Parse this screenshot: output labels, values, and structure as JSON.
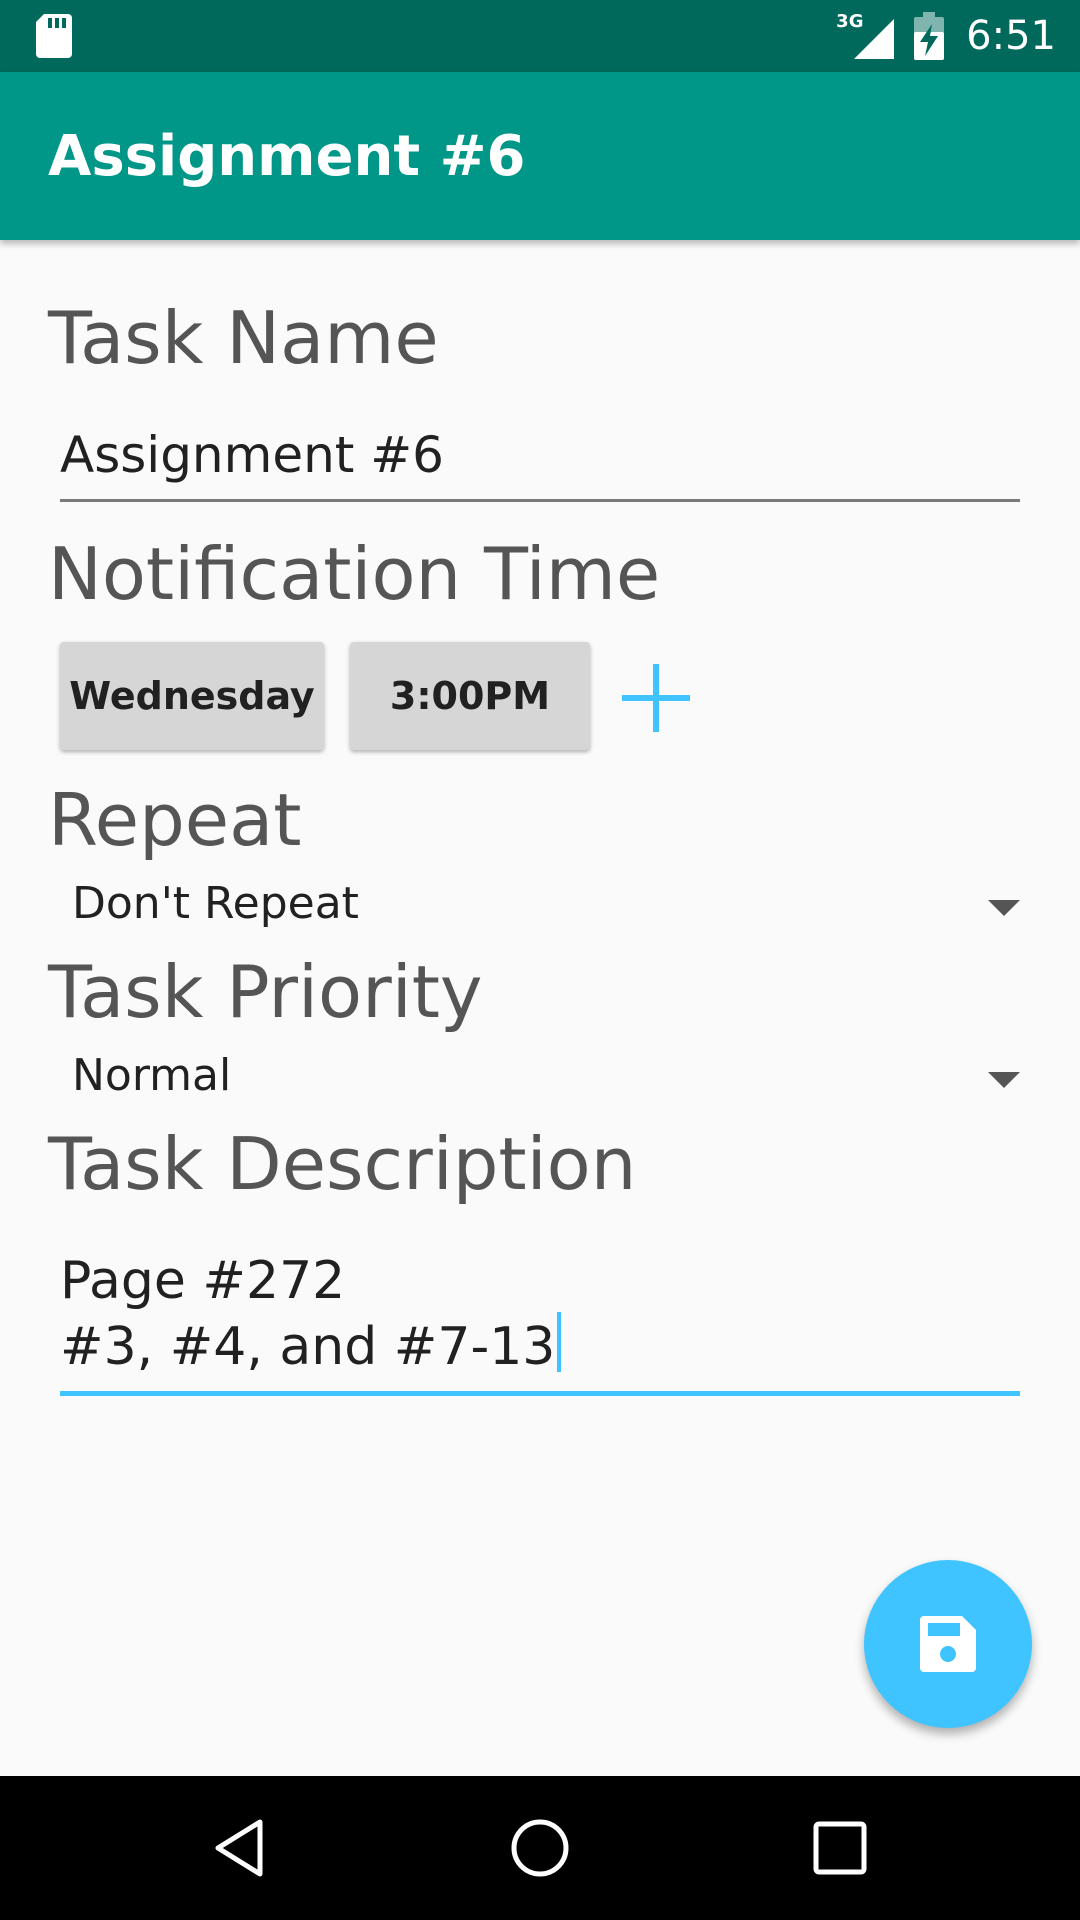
{
  "status_bar": {
    "network_label": "3G",
    "time": "6:51",
    "icons": [
      "sd-card-icon",
      "signal-icon",
      "battery-charging-icon"
    ]
  },
  "app_bar": {
    "title": "Assignment #6"
  },
  "form": {
    "task_name": {
      "label": "Task Name",
      "value": "Assignment #6"
    },
    "notification_time": {
      "label": "Notification Time",
      "day_button": "Wednesday",
      "time_button": "3:00PM",
      "add_icon": "plus-icon"
    },
    "repeat": {
      "label": "Repeat",
      "selected": "Don't Repeat"
    },
    "priority": {
      "label": "Task Priority",
      "selected": "Normal"
    },
    "description": {
      "label": "Task Description",
      "value": "Page #272\n#3, #4, and #7-13"
    }
  },
  "fab": {
    "icon": "save-icon"
  },
  "nav_bar": {
    "icons": [
      "back-icon",
      "home-icon",
      "recents-icon"
    ]
  },
  "colors": {
    "status_bar": "#00695c",
    "app_bar": "#009688",
    "accent": "#40c4ff",
    "label_text": "#555555",
    "button_bg": "#d6d6d6"
  }
}
